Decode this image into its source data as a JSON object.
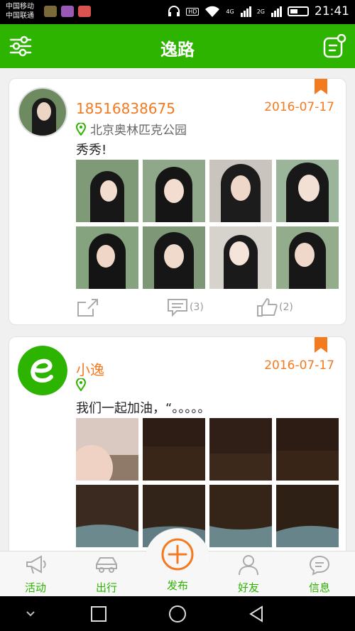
{
  "status_bar": {
    "carrier1": "中国移动",
    "carrier2": "中国联通",
    "hd": "HD",
    "net1": "4G",
    "net2": "2G",
    "time": "21:41"
  },
  "header": {
    "title": "逸路",
    "left_icon": "filter-sliders-icon",
    "right_icon": "compose-note-icon"
  },
  "posts": [
    {
      "user": "18516838675",
      "date": "2016-07-17",
      "location": "北京奥林匹克公园",
      "text": "秀秀!",
      "share_count": "",
      "comment_count": "(3)",
      "like_count": "(2)",
      "photos": 8
    },
    {
      "user": "小逸",
      "date": "2016-07-17",
      "location": "",
      "text": "我们一起加油，“。。。。。",
      "photos": 8
    }
  ],
  "tabs": [
    {
      "label": "活动",
      "icon": "megaphone-icon"
    },
    {
      "label": "出行",
      "icon": "car-icon"
    },
    {
      "label": "发布",
      "icon": "plus-circle-icon"
    },
    {
      "label": "好友",
      "icon": "friends-icon"
    },
    {
      "label": "信息",
      "icon": "message-icon"
    }
  ],
  "colors": {
    "brand_green": "#2db400",
    "accent_orange": "#f47a20"
  }
}
